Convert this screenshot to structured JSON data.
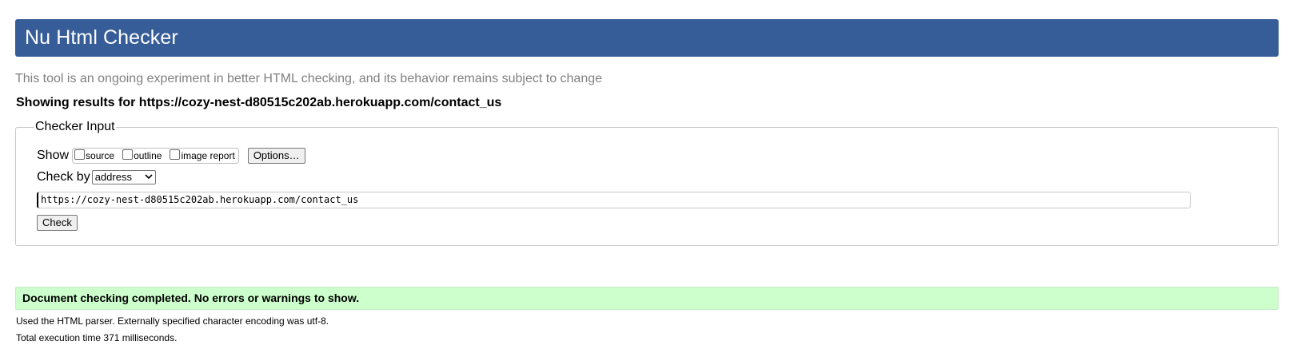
{
  "header": {
    "title": "Nu Html Checker"
  },
  "subtitle": "This tool is an ongoing experiment in better HTML checking, and its behavior remains subject to change",
  "results_heading": "Showing results for https://cozy-nest-d80515c202ab.herokuapp.com/contact_us",
  "checker_input": {
    "legend": "Checker Input",
    "show_label": "Show",
    "show_options": [
      {
        "label": "source",
        "checked": false
      },
      {
        "label": "outline",
        "checked": false
      },
      {
        "label": "image report",
        "checked": false
      }
    ],
    "options_button": "Options…",
    "check_by_label": "Check by",
    "check_by_selected": "address",
    "url_value": "https://cozy-nest-d80515c202ab.herokuapp.com/contact_us",
    "check_button": "Check"
  },
  "result": {
    "message": "Document checking completed. No errors or warnings to show.",
    "parser_info": "Used the HTML parser. Externally specified character encoding was utf-8.",
    "execution_time": "Total execution time 371 milliseconds."
  },
  "colors": {
    "header_bg": "#365d98",
    "success_bg": "#ccffcc",
    "subtitle_text": "#808080"
  }
}
